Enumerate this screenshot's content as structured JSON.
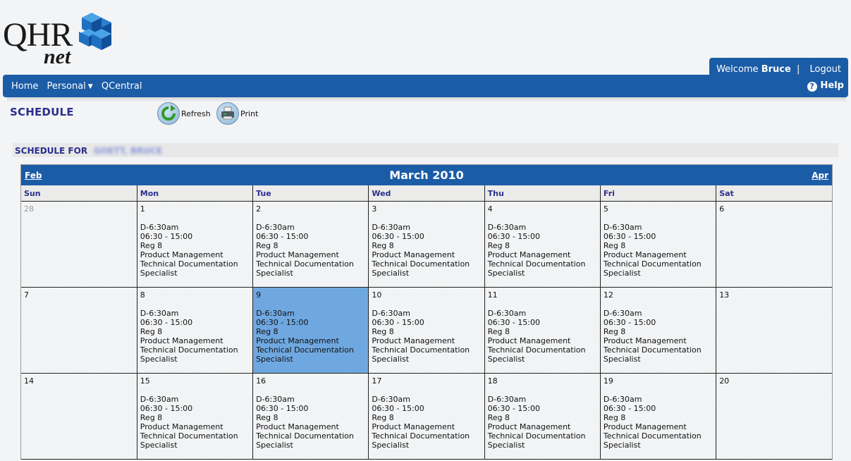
{
  "brand": {
    "logo_main": "QHR",
    "logo_sub": "net"
  },
  "header": {
    "welcome_prefix": "Welcome",
    "user_name": "Bruce",
    "separator": "|",
    "logout_label": "Logout",
    "help_label": "Help",
    "help_icon": "?"
  },
  "nav": {
    "items": [
      {
        "label": "Home"
      },
      {
        "label": "Personal",
        "has_dropdown": true
      },
      {
        "label": "QCentral"
      }
    ]
  },
  "page": {
    "title": "SCHEDULE",
    "refresh_label": "Refresh",
    "print_label": "Print",
    "schedule_for_label": "SCHEDULE FOR",
    "schedule_for_name": "GOETT, BRUCE"
  },
  "calendar": {
    "title": "March 2010",
    "prev_label": "Feb",
    "next_label": "Apr",
    "weekdays": [
      "Sun",
      "Mon",
      "Tue",
      "Wed",
      "Thu",
      "Fri",
      "Sat"
    ],
    "selected_day": "9",
    "shift": {
      "code": "D-6:30am",
      "hours": "06:30 - 15:00",
      "type": "Reg 8",
      "department": "Product Management",
      "position_1": "Technical Documentation",
      "position_2": "Specialist"
    },
    "weeks": [
      {
        "days": [
          {
            "num": "28",
            "other_month": true,
            "shift": false
          },
          {
            "num": "1",
            "shift": true
          },
          {
            "num": "2",
            "shift": true
          },
          {
            "num": "3",
            "shift": true
          },
          {
            "num": "4",
            "shift": true
          },
          {
            "num": "5",
            "shift": true
          },
          {
            "num": "6",
            "shift": false
          }
        ]
      },
      {
        "days": [
          {
            "num": "7",
            "shift": false
          },
          {
            "num": "8",
            "shift": true
          },
          {
            "num": "9",
            "shift": true,
            "today": true
          },
          {
            "num": "10",
            "shift": true
          },
          {
            "num": "11",
            "shift": true
          },
          {
            "num": "12",
            "shift": true
          },
          {
            "num": "13",
            "shift": false
          }
        ]
      },
      {
        "days": [
          {
            "num": "14",
            "shift": false
          },
          {
            "num": "15",
            "shift": true
          },
          {
            "num": "16",
            "shift": true
          },
          {
            "num": "17",
            "shift": true
          },
          {
            "num": "18",
            "shift": true
          },
          {
            "num": "19",
            "shift": true
          },
          {
            "num": "20",
            "shift": false
          }
        ]
      }
    ]
  },
  "colors": {
    "brand_blue": "#1b5ca6",
    "heading_navy": "#2b2f8c",
    "selected_day": "#6fa8e0"
  }
}
